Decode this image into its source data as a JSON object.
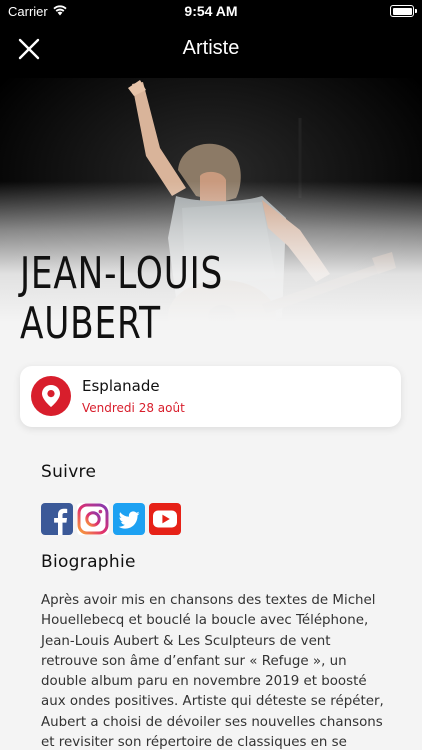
{
  "status_bar": {
    "carrier": "Carrier",
    "time": "9:54 AM",
    "wifi_icon": "wifi-icon",
    "battery_icon": "battery-icon"
  },
  "nav": {
    "title": "Artiste",
    "close_icon": "close-icon"
  },
  "hero": {
    "artist_name": "JEAN-LOUIS AUBERT",
    "photo_subject": "guitar player on stage raising his arm"
  },
  "venue": {
    "name": "Esplanade",
    "date": "Vendredi 28 août",
    "icon": "location-pin-icon",
    "accent_color": "#d81e2c"
  },
  "follow": {
    "title": "Suivre",
    "networks": [
      {
        "name": "facebook",
        "icon": "facebook-icon",
        "color": "#3b5998"
      },
      {
        "name": "instagram",
        "icon": "instagram-icon",
        "color": "#c13584"
      },
      {
        "name": "twitter",
        "icon": "twitter-icon",
        "color": "#1da1f2"
      },
      {
        "name": "youtube",
        "icon": "youtube-icon",
        "color": "#e62117"
      }
    ]
  },
  "biography": {
    "title": "Biographie",
    "text": "Après avoir mis en chansons des textes de Michel Houellebecq et bouclé la boucle avec Téléphone, Jean-Louis Aubert & Les Sculpteurs de vent retrouve son âme d’enfant sur « Refuge », un double album paru en novembre 2019 et boosté aux ondes positives. Artiste qui déteste se répéter, Aubert a choisi de dévoiler ses nouvelles chansons et revisiter son répertoire de classiques en se produisant seul sur"
  }
}
